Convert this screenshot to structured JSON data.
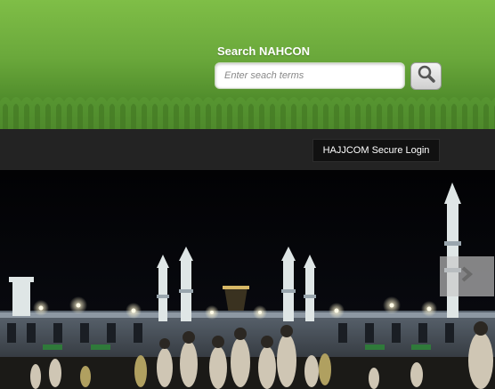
{
  "search": {
    "label": "Search NAHCON",
    "placeholder": "Enter seach terms",
    "button_icon": "magnifier-icon"
  },
  "topbar": {
    "login_label": "HAJJCOM Secure Login"
  },
  "slider": {
    "next_icon": "chevron-right-icon"
  },
  "colors": {
    "header_green": "#6aa83b",
    "topbar": "#232323",
    "login_bg": "#111111"
  }
}
